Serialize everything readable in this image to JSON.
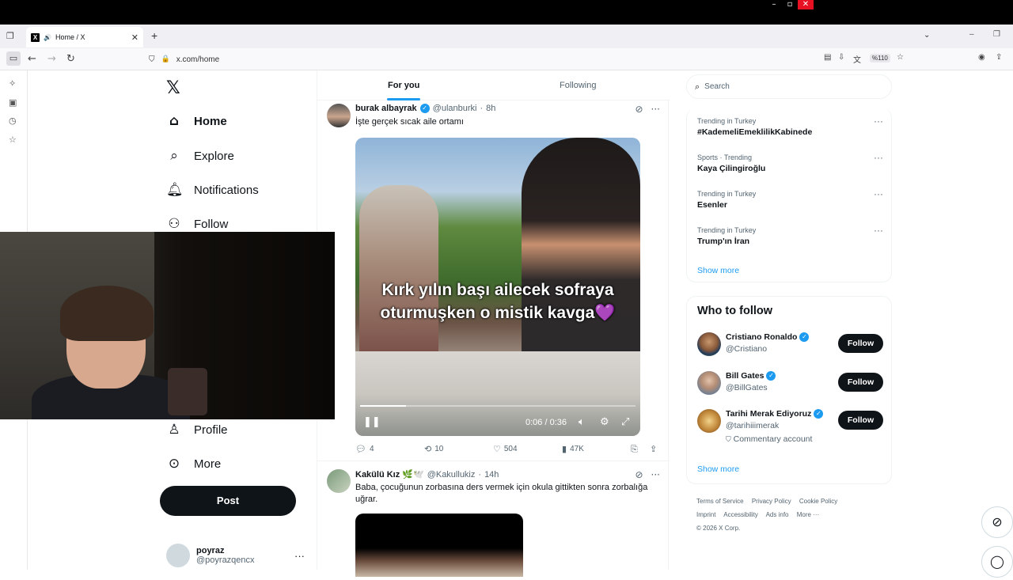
{
  "browser": {
    "tab_title": "Home / X",
    "tab_audio_icon": "speaker-icon",
    "url": "x.com/home",
    "zoom": "%110"
  },
  "nav": {
    "items": [
      {
        "label": "Home",
        "icon": "home-icon"
      },
      {
        "label": "Explore",
        "icon": "search-icon"
      },
      {
        "label": "Notifications",
        "icon": "bell-icon"
      },
      {
        "label": "Follow",
        "icon": "person-plus-icon"
      },
      {
        "label": "Profile",
        "icon": "person-icon"
      },
      {
        "label": "More",
        "icon": "more-circle-icon"
      }
    ],
    "post_label": "Post",
    "account": {
      "name": "poyraz",
      "handle": "@poyrazqencx"
    }
  },
  "feed": {
    "tabs": [
      "For you",
      "Following"
    ],
    "tweets": [
      {
        "name": "burak albayrak",
        "handle": "@ulanburki",
        "time": "8h",
        "text": "İşte gerçek sıcak aile ortamı",
        "video_caption_1": "Kırk yılın başı ailecek sofraya",
        "video_caption_2": "oturmuşken o mistik kavga💜",
        "video_time": "0:06 / 0:36",
        "video_progress": 0.167,
        "replies": "4",
        "reposts": "10",
        "likes": "504",
        "views": "47K"
      },
      {
        "name": "Kakülü Kız 🌿🕊️",
        "handle": "@Kakullukiz",
        "time": "14h",
        "text": "Baba, çocuğunun zorbasına ders vermek için okula gittikten sonra zorbalığa uğrar."
      }
    ]
  },
  "right": {
    "search_placeholder": "Search",
    "trends": [
      {
        "meta": "Trending in Turkey",
        "title": "#KademeliEmeklilikKabinede"
      },
      {
        "meta": "Sports · Trending",
        "title": "Kaya Çilingiroğlu"
      },
      {
        "meta": "Trending in Turkey",
        "title": "Esenler"
      },
      {
        "meta": "Trending in Turkey",
        "title": "Trump'ın İran"
      }
    ],
    "show_more": "Show more",
    "who_to_follow_title": "Who to follow",
    "who_to_follow": [
      {
        "name": "Cristiano Ronaldo",
        "handle": "@Cristiano",
        "sub": ""
      },
      {
        "name": "Bill Gates",
        "handle": "@BillGates",
        "sub": ""
      },
      {
        "name": "Tarihi Merak Ediyoruz",
        "handle": "@tarihiiimerak",
        "sub": "Commentary account"
      }
    ],
    "follow_label": "Follow",
    "show_more_2": "Show more",
    "footer": [
      "Terms of Service",
      "Privacy Policy",
      "Cookie Policy",
      "Imprint",
      "Accessibility",
      "Ads info",
      "More ···",
      "© 2026 X Corp."
    ]
  },
  "colors": {
    "accent": "#1d9bf0",
    "text": "#0f1419",
    "muted": "#536471"
  }
}
